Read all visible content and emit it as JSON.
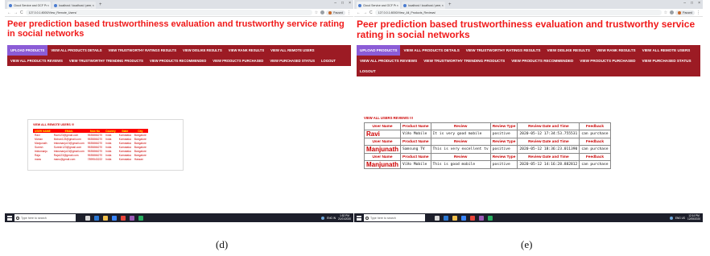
{
  "panel_d": {
    "tabs": [
      {
        "label": "Cloud Service and OCF Provider"
      },
      {
        "label": "localhost / localhost / peer_pre"
      }
    ],
    "url": "127.0.0.1:8000/View_Remote_Users/",
    "paused": "Paused",
    "page_title": "Peer prediction based trustworthiness evaluation and trustworthy service rating in social networks",
    "menu": [
      "UPLOAD PRODUCTS",
      "VIEW ALL PRODUCTS DETAILS",
      "VIEW TRUSTWORTHY RATINGS RESULTS",
      "VIEW DISLIKE RESULTS",
      "VIEW RANK RESULTS",
      "VIEW ALL REMOTE USERS",
      "VIEW ALL PRODUCTS REVIEWS",
      "VIEW TRUSTWORTHY TRENDING PRODUCTS",
      "VIEW PRODUCTS RECOMMENDED",
      "VIEW PRODUCTS PURCHASED",
      "VIEW PURCHASED STATUS",
      "LOGOUT"
    ],
    "users_title": "VIEW ALL REMOTE USERS !!!",
    "users_headers": [
      "USER NAME",
      "EMAIL",
      "Mob No",
      "Country",
      "State",
      "City"
    ],
    "users_rows": [
      [
        "Ravi",
        "Ravi123@gmail.com",
        "9535866270",
        "India",
        "Karnataka",
        "Bangalore"
      ],
      [
        "Mohan",
        "Mohan123@gmail.com",
        "9535866270",
        "India",
        "Karnataka",
        "Bangalore"
      ],
      [
        "Manjunath",
        "tmksmanju13@gmail.com",
        "9535866270",
        "India",
        "Karnataka",
        "Bangalore"
      ],
      [
        "Suresh",
        "Suresh123@gmail.com",
        "9535866270",
        "India",
        "Karnataka",
        "Bangalore"
      ],
      [
        "tmksmanju",
        "tmksmanju13@gmail.com",
        "9535866270",
        "India",
        "Karnataka",
        "Bangalore"
      ],
      [
        "Raja",
        "Raja123@gmail.com",
        "9535866270",
        "India",
        "Karnataka",
        "Bangalore"
      ],
      [
        "manu",
        "manu@gmail.com",
        "7899543222",
        "India",
        "Karnataka",
        "Hassan"
      ]
    ],
    "taskbar": {
      "search_placeholder": "Type here to search",
      "time": "1:52 PM",
      "date": "21/01/2020",
      "lang": "ENG IN"
    },
    "caption": "(d)"
  },
  "panel_e": {
    "tabs": [
      {
        "label": "Cloud Service and OCF Provider"
      },
      {
        "label": "localhost / localhost / peer_pre"
      }
    ],
    "url": "127.0.0.1:8000/View_All_Products_Reviews/",
    "paused": "Paused",
    "page_title": "Peer prediction based trustworthiness evaluation and trustworthy service rating in social networks",
    "menu": [
      "UPLOAD PRODUCTS",
      "VIEW ALL PRODUCTS DETAILS",
      "VIEW TRUSTWORTHY RATINGS RESULTS",
      "VIEW DISLIKE RESULTS",
      "VIEW RANK RESULTS",
      "VIEW ALL REMOTE USERS",
      "VIEW ALL PRODUCTS REVIEWS",
      "VIEW TRUSTWORTHY TRENDING PRODUCTS",
      "VIEW PRODUCTS RECOMMENDED",
      "VIEW PRODUCTS PURCHASED",
      "VIEW PURCHASED STATUS",
      "LOGOUT"
    ],
    "reviews_title": "VIEW ALL USERS REVIEWS !!!",
    "reviews_headers": [
      "User Name",
      "Product Name",
      "Review",
      "Review Type",
      "Review Date and Time",
      "Feedback"
    ],
    "reviews_rows": [
      [
        "Ravi",
        "ViVo Mobile",
        "It is very good mobile",
        "positive",
        "2020-05-12 17:34:53.755531",
        "can purchase"
      ],
      [
        "Manjunath",
        "Samsung TV",
        "This is very excellent tv",
        "positive",
        "2020-05-12 18:36:23.011390",
        "can purchase"
      ],
      [
        "Manjunath",
        "ViVo Mobile",
        "This is good mobile",
        "positive",
        "2020-05-12 14:16:28.882812",
        "can purchase"
      ]
    ],
    "taskbar": {
      "search_placeholder": "Type here to search",
      "time": "12:14 PM",
      "date": "12/05/2020",
      "lang": "ENG US"
    },
    "caption": "(e)"
  },
  "colors": {
    "title_red": "#f01a1a",
    "menu_bg": "#9c1b24",
    "menu_active": "#8b5cd6",
    "header_cell_bg": "#ff0000",
    "header_cell_text": "#ffff00"
  }
}
